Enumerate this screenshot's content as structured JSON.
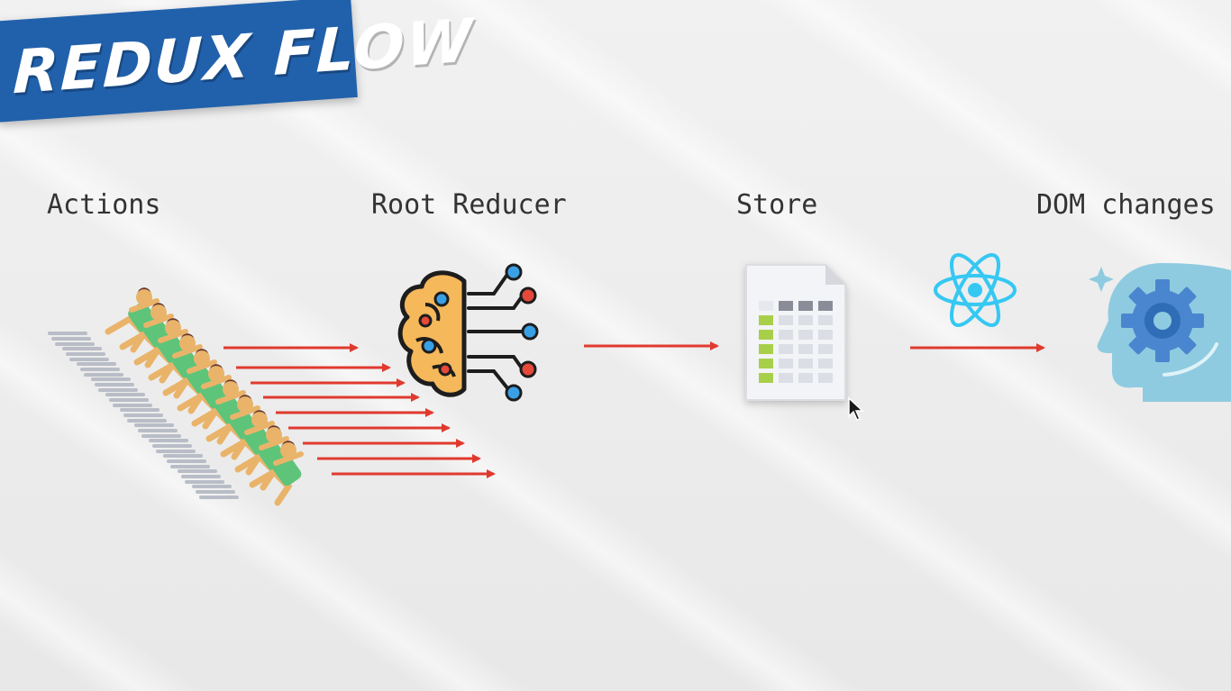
{
  "title": "REDUX FLOW",
  "stages": [
    {
      "label": "Actions",
      "icon": "running-people-icon"
    },
    {
      "label": "Root Reducer",
      "icon": "brain-circuit-icon"
    },
    {
      "label": "Store",
      "icon": "spreadsheet-document-icon"
    },
    {
      "label": "DOM changes",
      "icon": "head-gear-icon"
    }
  ],
  "connector_icon": "react-logo-icon",
  "colors": {
    "banner": "#2161ac",
    "arrow": "#e03a2e",
    "react": "#35c8f2",
    "brain": "#f5b85a",
    "node_blue": "#3aa0e6",
    "node_red": "#e5493a",
    "head": "#8fcbe0",
    "gear": "#4a86cf",
    "sheet_green": "#a8cf4a"
  }
}
